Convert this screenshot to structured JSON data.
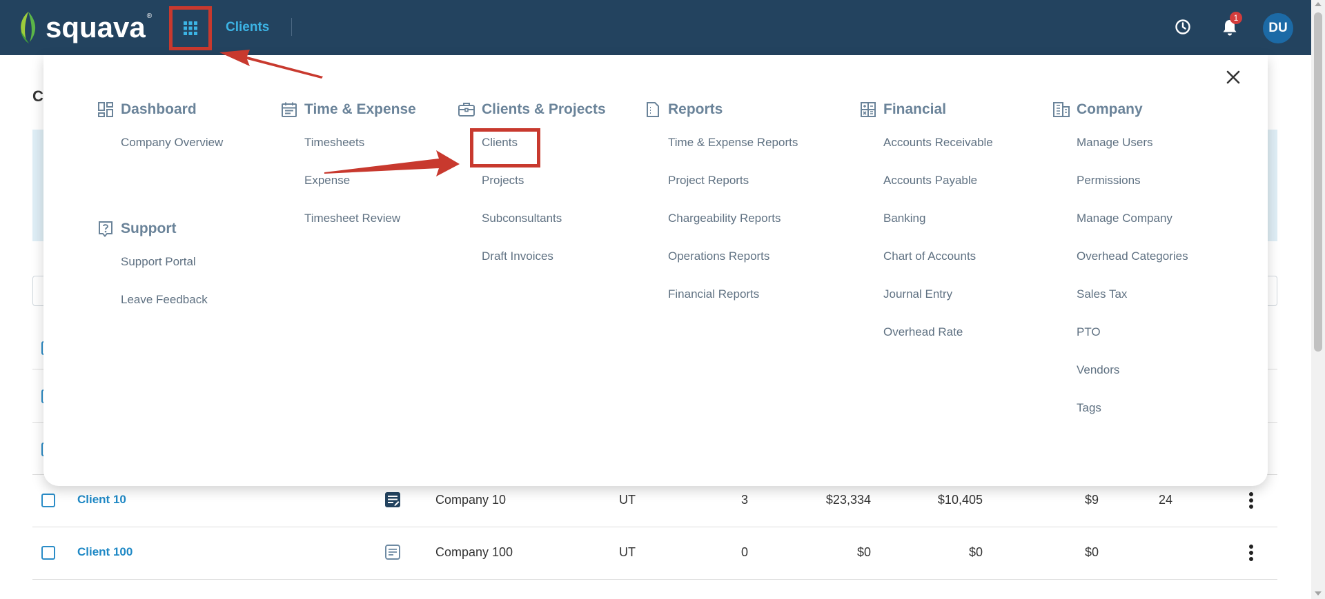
{
  "topbar": {
    "brand": "squava",
    "current_section": "Clients",
    "notification_count": "1",
    "avatar_initials": "DU"
  },
  "background_page": {
    "title_fragment": "C"
  },
  "rows": [
    {
      "name": "Client 10",
      "company": "Company 10",
      "state": "UT",
      "projects": "3",
      "ar": "$23,334",
      "ap": "$10,405",
      "wip": "$9",
      "users": "24",
      "note_state": "filled"
    },
    {
      "name": "Client 100",
      "company": "Company 100",
      "state": "UT",
      "projects": "0",
      "ar": "$0",
      "ap": "$0",
      "wip": "$0",
      "users": "",
      "note_state": "outline"
    }
  ],
  "menu": {
    "columns": [
      {
        "heading": "Dashboard",
        "icon": "dashboard-icon",
        "items": [
          "Company Overview"
        ]
      },
      {
        "heading": "Support",
        "icon": "question-icon",
        "items": [
          "Support Portal",
          "Leave Feedback"
        ]
      },
      {
        "heading": "Time & Expense",
        "icon": "calendar-icon",
        "items": [
          "Timesheets",
          "Expense",
          "Timesheet Review"
        ]
      },
      {
        "heading": "Clients & Projects",
        "icon": "briefcase-icon",
        "items": [
          "Clients",
          "Projects",
          "Subconsultants",
          "Draft Invoices"
        ]
      },
      {
        "heading": "Reports",
        "icon": "report-icon",
        "items": [
          "Time & Expense Reports",
          "Project Reports",
          "Chargeability Reports",
          "Operations Reports",
          "Financial Reports"
        ]
      },
      {
        "heading": "Financial",
        "icon": "calculator-icon",
        "items": [
          "Accounts Receivable",
          "Accounts Payable",
          "Banking",
          "Chart of Accounts",
          "Journal Entry",
          "Overhead Rate"
        ]
      },
      {
        "heading": "Company",
        "icon": "building-icon",
        "items": [
          "Manage Users",
          "Permissions",
          "Manage Company",
          "Overhead Categories",
          "Sales Tax",
          "PTO",
          "Vendors",
          "Tags"
        ]
      }
    ]
  },
  "colors": {
    "topbar_bg": "#23435f",
    "accent": "#3cb4e5",
    "link": "#1e88c5",
    "annotation_red": "#c8392e",
    "menu_heading": "#6a8399"
  }
}
